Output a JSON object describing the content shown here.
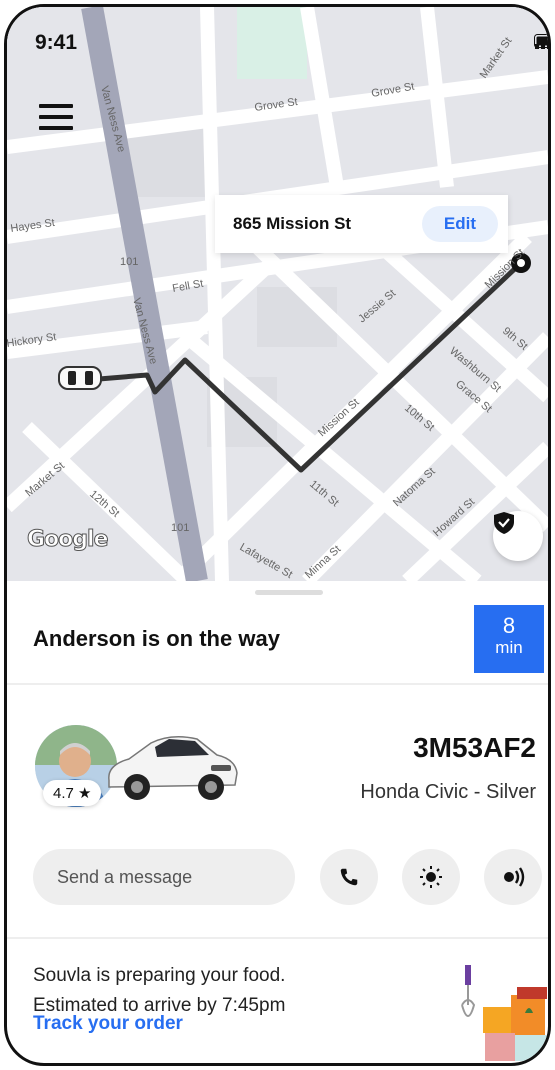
{
  "status_bar": {
    "time": "9:41"
  },
  "map": {
    "destination_address": "865 Mission St",
    "edit_label": "Edit",
    "attribution": "Google",
    "street_labels": [
      "Grove St",
      "Grove St",
      "Market St",
      "Van Ness Ave",
      "Hayes St",
      "101",
      "Fell St",
      "Van Ness Ave",
      "Jessie St",
      "Mission St",
      "9th St",
      "Washburn St",
      "Grace St",
      "Hickory St",
      "Mission St",
      "10th St",
      "Market St",
      "12th St",
      "11th St",
      "Natoma St",
      "Howard St",
      "101",
      "Lafayette St",
      "Minna St"
    ]
  },
  "trip": {
    "driver_status": "Anderson is on the way",
    "eta_value": "8",
    "eta_unit": "min"
  },
  "driver": {
    "rating": "4.7 ★",
    "plate": "3M53AF2",
    "vehicle": "Honda Civic - Silver"
  },
  "actions": {
    "message_placeholder": "Send a message",
    "icons": [
      "phone-icon",
      "light-icon",
      "sound-icon"
    ]
  },
  "order": {
    "line1": "Souvla is preparing your food.",
    "line2": "Estimated to arrive by 7:45pm",
    "track_label": "Track your order"
  },
  "colors": {
    "accent": "#276ef1",
    "route": "#333333",
    "highway": "#a3a6b8"
  }
}
